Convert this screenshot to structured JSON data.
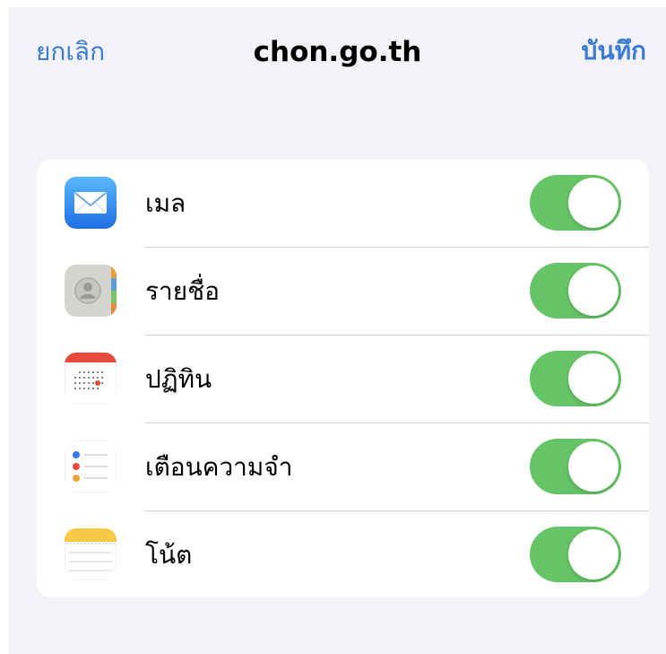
{
  "nav": {
    "cancel_label": "ยกเลิก",
    "title": "chon.go.th",
    "save_label": "บันทึก"
  },
  "accent_color": "#3a7bd5",
  "toggle_on_color": "#65c466",
  "items": [
    {
      "label": "เมล",
      "icon": "mail-icon",
      "enabled": true
    },
    {
      "label": "รายชื่อ",
      "icon": "contacts-icon",
      "enabled": true
    },
    {
      "label": "ปฏิทิน",
      "icon": "calendar-icon",
      "enabled": true
    },
    {
      "label": "เตือนความจำ",
      "icon": "reminders-icon",
      "enabled": true
    },
    {
      "label": "โน้ต",
      "icon": "notes-icon",
      "enabled": true
    }
  ]
}
